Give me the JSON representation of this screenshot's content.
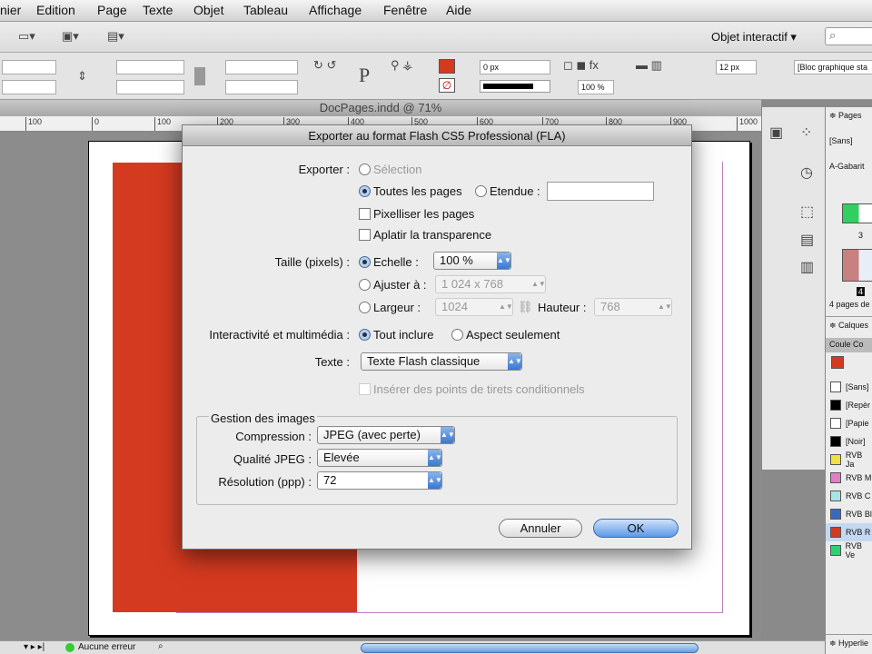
{
  "menu": [
    "nier",
    "Edition",
    "Page",
    "Texte",
    "Objet",
    "Tableau",
    "Affichage",
    "Fenêtre",
    "Aide"
  ],
  "toolbar": {
    "workspace": "Objet interactif ▾",
    "search_icon": "search-icon"
  },
  "control": {
    "stroke_weight": "0 px",
    "opacity": "100 %",
    "spacing": "12 px",
    "object_style": "[Bloc graphique sta"
  },
  "document": {
    "title": "DocPages.indd @ 71%",
    "ruler": [
      "100",
      "0",
      "100",
      "200",
      "300",
      "400",
      "500",
      "600",
      "700",
      "800",
      "900",
      "1000"
    ]
  },
  "status": {
    "errors": "Aucune erreur"
  },
  "panels": {
    "pages": {
      "title": "≑ Pages",
      "masters": [
        "[Sans]",
        "A-Gabarit"
      ],
      "page_numbers": [
        "3",
        "4"
      ],
      "summary": "4 pages de"
    },
    "layers": {
      "title": "≑ Calques"
    },
    "swatches": {
      "tabs": [
        "Coule",
        "Co"
      ],
      "items": [
        {
          "name": "[Sans]",
          "color": "#ffffff"
        },
        {
          "name": "[Repèr",
          "color": "#000000"
        },
        {
          "name": "[Papie",
          "color": "#ffffff"
        },
        {
          "name": "[Noir]",
          "color": "#000000"
        },
        {
          "name": "RVB Ja",
          "color": "#f0e040"
        },
        {
          "name": "RVB M",
          "color": "#e080c8"
        },
        {
          "name": "RVB C",
          "color": "#a8e4e4"
        },
        {
          "name": "RVB Bl",
          "color": "#3a6ac0"
        },
        {
          "name": "RVB R",
          "color": "#d43a20"
        },
        {
          "name": "RVB Ve",
          "color": "#30d070"
        }
      ]
    },
    "hyperlinks": {
      "title": "≑ Hyperlie"
    }
  },
  "dialog": {
    "title": "Exporter au format Flash CS5 Professional (FLA)",
    "export_label": "Exporter :",
    "selection": "Sélection",
    "all_pages": "Toutes les pages",
    "range": "Etendue :",
    "range_value": "",
    "rasterize": "Pixelliser les pages",
    "flatten": "Aplatir la transparence",
    "size_label": "Taille (pixels) :",
    "scale": "Echelle :",
    "scale_value": "100 %",
    "fit": "Ajuster à :",
    "fit_value": "1 024 x 768",
    "width": "Largeur :",
    "width_value": "1024",
    "height": "Hauteur :",
    "height_value": "768",
    "interactivity_label": "Interactivité et multimédia :",
    "include_all": "Tout inclure",
    "appearance_only": "Aspect seulement",
    "text_label": "Texte :",
    "text_value": "Texte Flash classique",
    "hyphen": "Insérer des points de tirets conditionnels",
    "images_group": "Gestion des images",
    "compression_label": "Compression :",
    "compression_value": "JPEG (avec perte)",
    "quality_label": "Qualité JPEG :",
    "quality_value": "Elevée",
    "resolution_label": "Résolution (ppp) :",
    "resolution_value": "72",
    "cancel": "Annuler",
    "ok": "OK"
  }
}
